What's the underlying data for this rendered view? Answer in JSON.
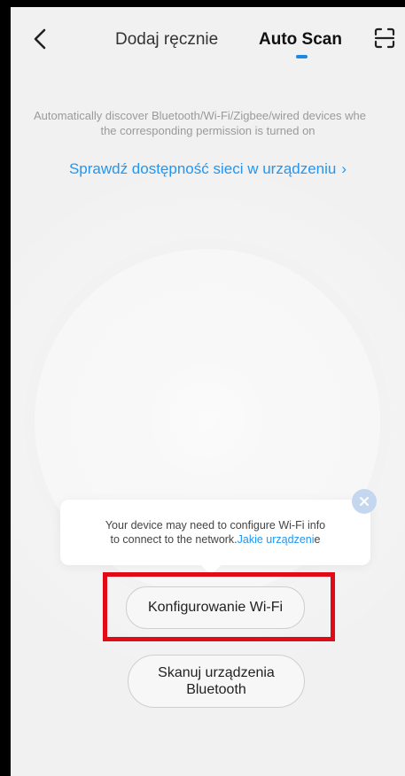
{
  "header": {
    "tab_manual": "Dodaj ręcznie",
    "tab_auto": "Auto Scan",
    "back_icon": "chevron-left-icon",
    "scan_icon": "scan-frame-icon"
  },
  "main": {
    "description_line1": "Automatically discover Bluetooth/Wi-Fi/Zigbee/wired devices whe",
    "description_line2": "the corresponding permission is turned on",
    "check_network_link": "Sprawdź dostępność sieci w urządzeniu",
    "check_network_chevron": "›"
  },
  "popup": {
    "text_line1": "Your device may need to configure Wi-Fi info",
    "text_line2": "to connect to the network.",
    "link_text": "Jakie urządzeni",
    "text_tail": "e",
    "close_icon": "close-icon"
  },
  "buttons": {
    "configure_wifi": "Konfigurowanie Wi-Fi",
    "scan_bluetooth": "Skanuj urządzenia\nBluetooth"
  },
  "colors": {
    "accent": "#2196f3",
    "highlight": "#e10a17",
    "background": "#f1f1f1"
  }
}
